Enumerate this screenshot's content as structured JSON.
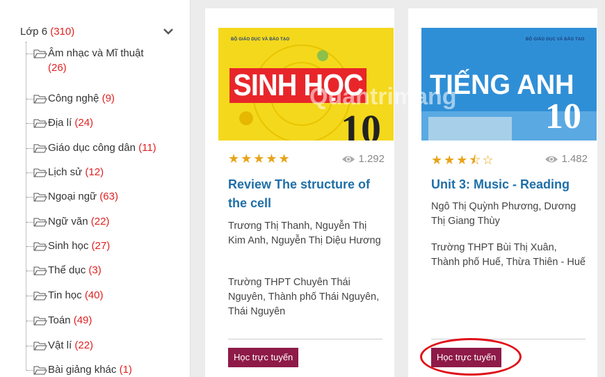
{
  "sidebar": {
    "grade": {
      "label": "Lớp 6",
      "count": "(310)"
    },
    "items": [
      {
        "label": "Âm nhạc và Mĩ thuật",
        "count": "(26)"
      },
      {
        "label": "Công nghệ",
        "count": "(9)"
      },
      {
        "label": "Địa lí",
        "count": "(24)"
      },
      {
        "label": "Giáo dục công dân",
        "count": "(11)"
      },
      {
        "label": "Lịch sử",
        "count": "(12)"
      },
      {
        "label": "Ngoại ngữ",
        "count": "(63)"
      },
      {
        "label": "Ngữ văn",
        "count": "(22)"
      },
      {
        "label": "Sinh học",
        "count": "(27)"
      },
      {
        "label": "Thể dục",
        "count": "(3)"
      },
      {
        "label": "Tin học",
        "count": "(40)"
      },
      {
        "label": "Toán",
        "count": "(49)"
      },
      {
        "label": "Vật lí",
        "count": "(22)"
      },
      {
        "label": "Bài giảng khác",
        "count": "(1)"
      }
    ]
  },
  "cards": [
    {
      "cover_publisher": "BỘ GIÁO DỤC VÀ ĐÀO TẠO",
      "cover_title": "SINH HỌC",
      "cover_number": "10",
      "rating": 5,
      "stars": "★★★★★",
      "views": "1.292",
      "title": "Review The structure of the cell",
      "authors": "Trương Thị Thanh, Nguyễn Thị Kim Anh, Nguyễn Thị Diệu Hương",
      "school": "Trường THPT Chuyên Thái Nguyên, Thành phố Thái Nguyên, Thái Nguyên",
      "button": "Học trực tuyến"
    },
    {
      "cover_publisher": "BỘ GIÁO DỤC VÀ ĐÀO TẠO",
      "cover_title": "TIẾNG ANH",
      "cover_number": "10",
      "rating": 3.5,
      "stars": "★★★",
      "stars_half": "⯪",
      "stars_empty": "☆",
      "views": "1.482",
      "title": "Unit 3: Music - Reading",
      "authors": "Ngô Thị Quỳnh Phương, Dương Thị Giang Thùy",
      "school": "Trường THPT Bùi Thị Xuân, Thành phố Huế, Thừa Thiên - Huế",
      "button": "Học trực tuyến"
    }
  ],
  "watermark": "Quantrimang",
  "colors": {
    "accent_link": "#1f6fa8",
    "button": "#8e1a48",
    "count": "#e02020",
    "star": "#e8a317",
    "highlight": "#e0101a"
  }
}
